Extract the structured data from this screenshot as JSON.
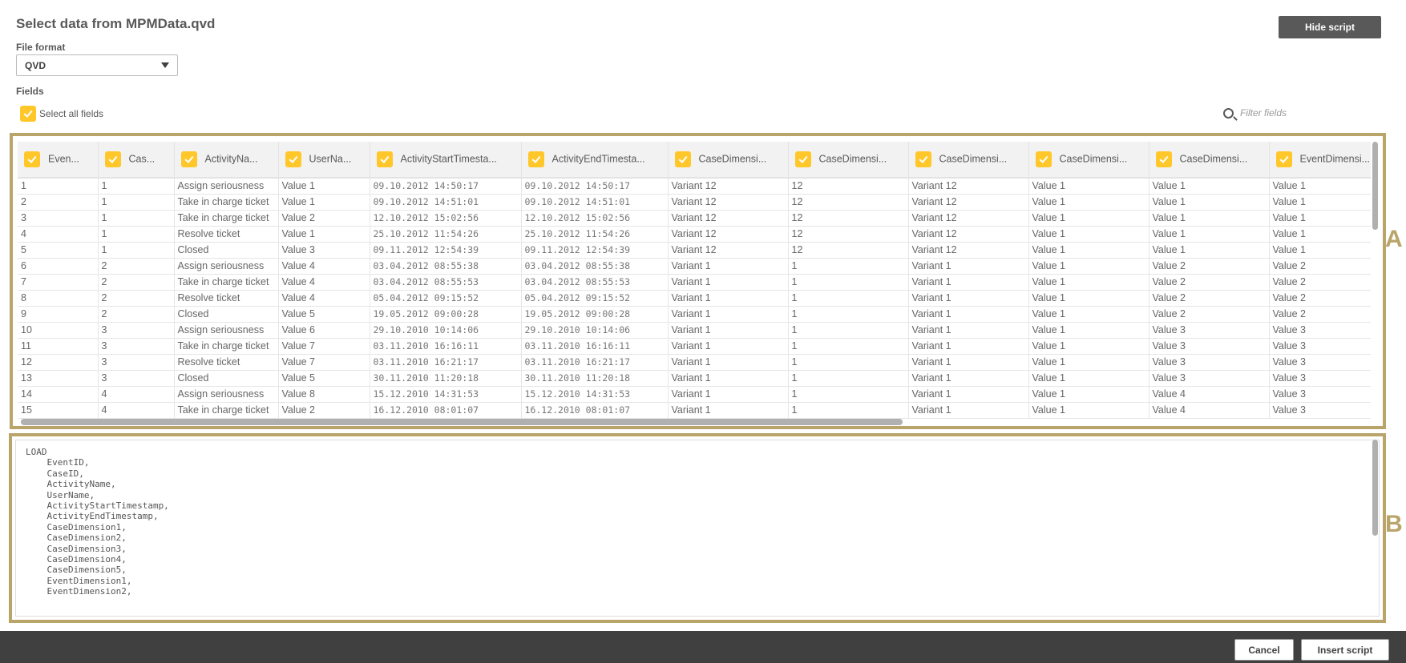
{
  "title": "Select data from MPMData.qvd",
  "hide_script": "Hide script",
  "file_format": {
    "label": "File format",
    "value": "QVD"
  },
  "fields_label": "Fields",
  "select_all": "Select all fields",
  "filter_placeholder": "Filter fields",
  "accent": "#ffc72a",
  "highlight": "#b9a46a",
  "markers": {
    "a": "A",
    "b": "B"
  },
  "columns": [
    "Even...",
    "Cas...",
    "ActivityNa...",
    "UserNa...",
    "ActivityStartTimesta...",
    "ActivityEndTimesta...",
    "CaseDimensi...",
    "CaseDimensi...",
    "CaseDimensi...",
    "CaseDimensi...",
    "CaseDimensi...",
    "EventDimensi..."
  ],
  "rows": [
    [
      "1",
      "1",
      "Assign seriousness",
      "Value 1",
      "09.10.2012 14:50:17",
      "09.10.2012 14:50:17",
      "Variant 12",
      "12",
      "Variant 12",
      "Value 1",
      "Value 1",
      "Value 1"
    ],
    [
      "2",
      "1",
      "Take in charge ticket",
      "Value 1",
      "09.10.2012 14:51:01",
      "09.10.2012 14:51:01",
      "Variant 12",
      "12",
      "Variant 12",
      "Value 1",
      "Value 1",
      "Value 1"
    ],
    [
      "3",
      "1",
      "Take in charge ticket",
      "Value 2",
      "12.10.2012 15:02:56",
      "12.10.2012 15:02:56",
      "Variant 12",
      "12",
      "Variant 12",
      "Value 1",
      "Value 1",
      "Value 1"
    ],
    [
      "4",
      "1",
      "Resolve ticket",
      "Value 1",
      "25.10.2012 11:54:26",
      "25.10.2012 11:54:26",
      "Variant 12",
      "12",
      "Variant 12",
      "Value 1",
      "Value 1",
      "Value 1"
    ],
    [
      "5",
      "1",
      "Closed",
      "Value 3",
      "09.11.2012 12:54:39",
      "09.11.2012 12:54:39",
      "Variant 12",
      "12",
      "Variant 12",
      "Value 1",
      "Value 1",
      "Value 1"
    ],
    [
      "6",
      "2",
      "Assign seriousness",
      "Value 4",
      "03.04.2012 08:55:38",
      "03.04.2012 08:55:38",
      "Variant 1",
      "1",
      "Variant 1",
      "Value 1",
      "Value 2",
      "Value 2"
    ],
    [
      "7",
      "2",
      "Take in charge ticket",
      "Value 4",
      "03.04.2012 08:55:53",
      "03.04.2012 08:55:53",
      "Variant 1",
      "1",
      "Variant 1",
      "Value 1",
      "Value 2",
      "Value 2"
    ],
    [
      "8",
      "2",
      "Resolve ticket",
      "Value 4",
      "05.04.2012 09:15:52",
      "05.04.2012 09:15:52",
      "Variant 1",
      "1",
      "Variant 1",
      "Value 1",
      "Value 2",
      "Value 2"
    ],
    [
      "9",
      "2",
      "Closed",
      "Value 5",
      "19.05.2012 09:00:28",
      "19.05.2012 09:00:28",
      "Variant 1",
      "1",
      "Variant 1",
      "Value 1",
      "Value 2",
      "Value 2"
    ],
    [
      "10",
      "3",
      "Assign seriousness",
      "Value 6",
      "29.10.2010 10:14:06",
      "29.10.2010 10:14:06",
      "Variant 1",
      "1",
      "Variant 1",
      "Value 1",
      "Value 3",
      "Value 3"
    ],
    [
      "11",
      "3",
      "Take in charge ticket",
      "Value 7",
      "03.11.2010 16:16:11",
      "03.11.2010 16:16:11",
      "Variant 1",
      "1",
      "Variant 1",
      "Value 1",
      "Value 3",
      "Value 3"
    ],
    [
      "12",
      "3",
      "Resolve ticket",
      "Value 7",
      "03.11.2010 16:21:17",
      "03.11.2010 16:21:17",
      "Variant 1",
      "1",
      "Variant 1",
      "Value 1",
      "Value 3",
      "Value 3"
    ],
    [
      "13",
      "3",
      "Closed",
      "Value 5",
      "30.11.2010 11:20:18",
      "30.11.2010 11:20:18",
      "Variant 1",
      "1",
      "Variant 1",
      "Value 1",
      "Value 3",
      "Value 3"
    ],
    [
      "14",
      "4",
      "Assign seriousness",
      "Value 8",
      "15.12.2010 14:31:53",
      "15.12.2010 14:31:53",
      "Variant 1",
      "1",
      "Variant 1",
      "Value 1",
      "Value 4",
      "Value 3"
    ],
    [
      "15",
      "4",
      "Take in charge ticket",
      "Value 2",
      "16.12.2010 08:01:07",
      "16.12.2010 08:01:07",
      "Variant 1",
      "1",
      "Variant 1",
      "Value 1",
      "Value 4",
      "Value 3"
    ]
  ],
  "script": "LOAD\n    EventID,\n    CaseID,\n    ActivityName,\n    UserName,\n    ActivityStartTimestamp,\n    ActivityEndTimestamp,\n    CaseDimension1,\n    CaseDimension2,\n    CaseDimension3,\n    CaseDimension4,\n    CaseDimension5,\n    EventDimension1,\n    EventDimension2,",
  "footer": {
    "cancel": "Cancel",
    "insert": "Insert script"
  }
}
